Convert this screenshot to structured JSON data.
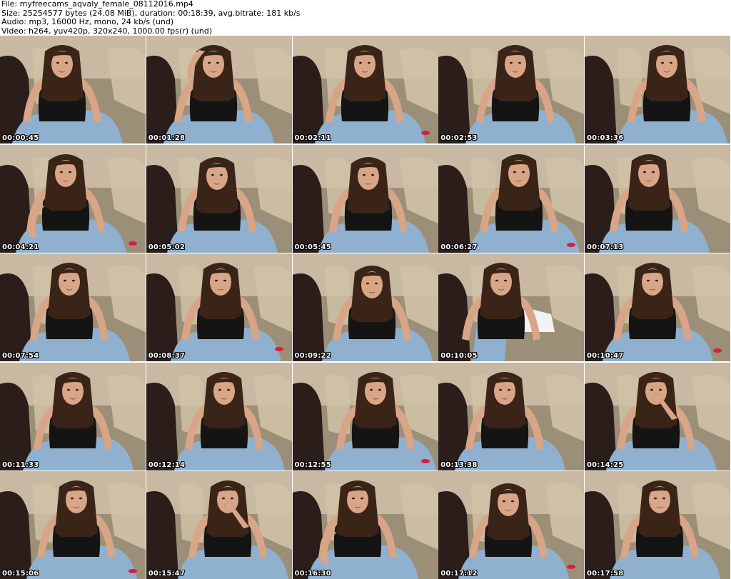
{
  "header": {
    "file_line": "File: myfreecams_aqvaly_female_08112016.mp4",
    "size_line": "Size: 25254577 bytes (24.08 MiB), duration: 00:18:39, avg.bitrate: 181 kb/s",
    "audio_line": "Audio: mp3, 16000 Hz, mono, 24 kb/s (und)",
    "video_line": "Video: h264, yuv420p, 320x240, 1000.00 fps(r) (und)"
  },
  "thumbnails": [
    {
      "timestamp": "00:00:45",
      "pose": "sitting"
    },
    {
      "timestamp": "00:01:28",
      "pose": "hand-on-head"
    },
    {
      "timestamp": "00:02:11",
      "pose": "sitting"
    },
    {
      "timestamp": "00:02:53",
      "pose": "sitting"
    },
    {
      "timestamp": "00:03:36",
      "pose": "sitting"
    },
    {
      "timestamp": "00:04:21",
      "pose": "leaning"
    },
    {
      "timestamp": "00:05:02",
      "pose": "looking-down"
    },
    {
      "timestamp": "00:05:45",
      "pose": "looking-down"
    },
    {
      "timestamp": "00:06:27",
      "pose": "sitting"
    },
    {
      "timestamp": "00:07:13",
      "pose": "sitting"
    },
    {
      "timestamp": "00:07:54",
      "pose": "sitting"
    },
    {
      "timestamp": "00:08:37",
      "pose": "sitting"
    },
    {
      "timestamp": "00:09:22",
      "pose": "looking-down"
    },
    {
      "timestamp": "00:10:05",
      "pose": "leg-raised"
    },
    {
      "timestamp": "00:10:47",
      "pose": "sitting"
    },
    {
      "timestamp": "00:11:33",
      "pose": "sitting"
    },
    {
      "timestamp": "00:12:14",
      "pose": "sitting"
    },
    {
      "timestamp": "00:12:55",
      "pose": "sitting"
    },
    {
      "timestamp": "00:13:38",
      "pose": "sitting"
    },
    {
      "timestamp": "00:14:25",
      "pose": "hand-on-face"
    },
    {
      "timestamp": "00:15:06",
      "pose": "sitting"
    },
    {
      "timestamp": "00:15:47",
      "pose": "hand-on-face"
    },
    {
      "timestamp": "00:16:30",
      "pose": "leaning"
    },
    {
      "timestamp": "00:17:12",
      "pose": "looking-down"
    },
    {
      "timestamp": "00:17:58",
      "pose": "sitting"
    }
  ],
  "colors": {
    "wall": "#c9b9a3",
    "sofa": "#9c8f78",
    "cushion": "#cfc2a6",
    "chair": "#2a1d1a",
    "skin": "#d8a587",
    "hair": "#3a2418",
    "top": "#141414",
    "jeans": "#8fb0cf",
    "accent": "#d81e3f"
  }
}
